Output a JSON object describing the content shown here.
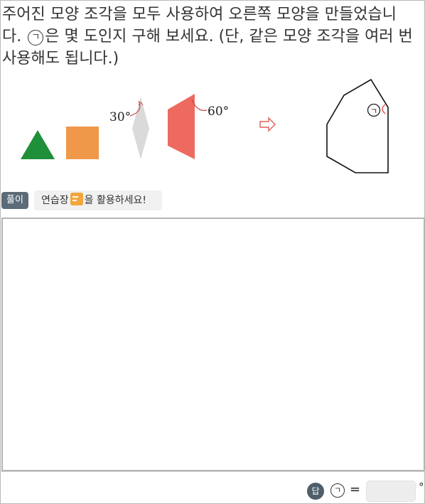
{
  "question": {
    "line1": "주어진 모양 조각을 모두 사용하여 오른쪽 모양을 만들었습니",
    "line2_pre": "다. ",
    "marker": "ㄱ",
    "line2_post": "은 몇 도인지 구해 보세요. (단, 같은 모양 조각을 여러 번",
    "line3": "사용해도 됩니다.)"
  },
  "figure": {
    "angle_rhombus": "30°",
    "angle_trapezoid": "60°",
    "target_marker": "ㄱ",
    "colors": {
      "triangle": "#1f8f3a",
      "square": "#f0984a",
      "rhombus": "#dadada",
      "trapezoid": "#ee6a5f",
      "arrow": "#e0605a"
    }
  },
  "toolbar": {
    "solution_label": "풀이",
    "hint_pre": "연습장",
    "hint_post": "을 활용하세요!"
  },
  "answer": {
    "badge": "답",
    "marker": "ㄱ",
    "equals": "=",
    "value": "",
    "unit": "°"
  }
}
